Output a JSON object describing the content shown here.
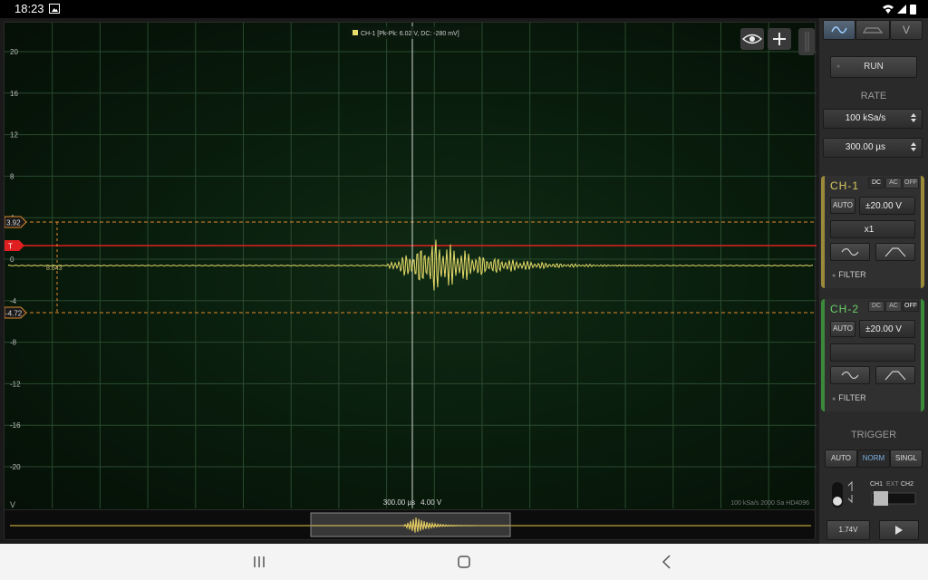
{
  "status": {
    "time": "18:23",
    "icon": "image-icon"
  },
  "scope": {
    "readout": "CH-1 [Pk-Pk: 6.02 V, DC: -280 mV]",
    "y_ticks": [
      "20",
      "16",
      "12",
      "8",
      "4",
      "0",
      "-4",
      "-8",
      "-12",
      "-16",
      "-20"
    ],
    "y_unit": "V",
    "cursor_top": "3.92",
    "cursor_bottom": "-4.72",
    "trigger_marker": "T",
    "cursor_delta": "8.643",
    "bottom_time": "300.00 µs",
    "bottom_volt": "4.00 V",
    "info": "100 kSa/s   2000 Sa   HD4096",
    "colors": {
      "trace": "#e8dc6a",
      "trigger": "#e02020",
      "cursor": "#e08a30",
      "grid": "#2a4a2e"
    }
  },
  "panel": {
    "tabs": [
      "wave-icon",
      "car-icon",
      "V"
    ],
    "tab_v": "V",
    "run": "RUN",
    "rate_label": "RATE",
    "rate_value": "100 kSa/s",
    "time_value": "300.00 µs",
    "ch1": {
      "title": "CH-1",
      "dc": "DC",
      "ac": "AC",
      "off": "OFF",
      "auto": "AUTO",
      "range": "±20.00 V",
      "probe": "x1",
      "filter": "FILTER"
    },
    "ch2": {
      "title": "CH-2",
      "dc": "DC",
      "ac": "AC",
      "off": "OFF",
      "auto": "AUTO",
      "range": "±20.00 V",
      "probe": "",
      "filter": "FILTER"
    },
    "trigger_label": "TRIGGER",
    "trig_auto": "AUTO",
    "trig_norm": "NORM",
    "trig_single": "SINGL",
    "trig_src": {
      "ch1": "CH1",
      "ext": "EXT",
      "ch2": "CH2"
    },
    "trig_level": "1.74V",
    "play": "play-icon"
  }
}
